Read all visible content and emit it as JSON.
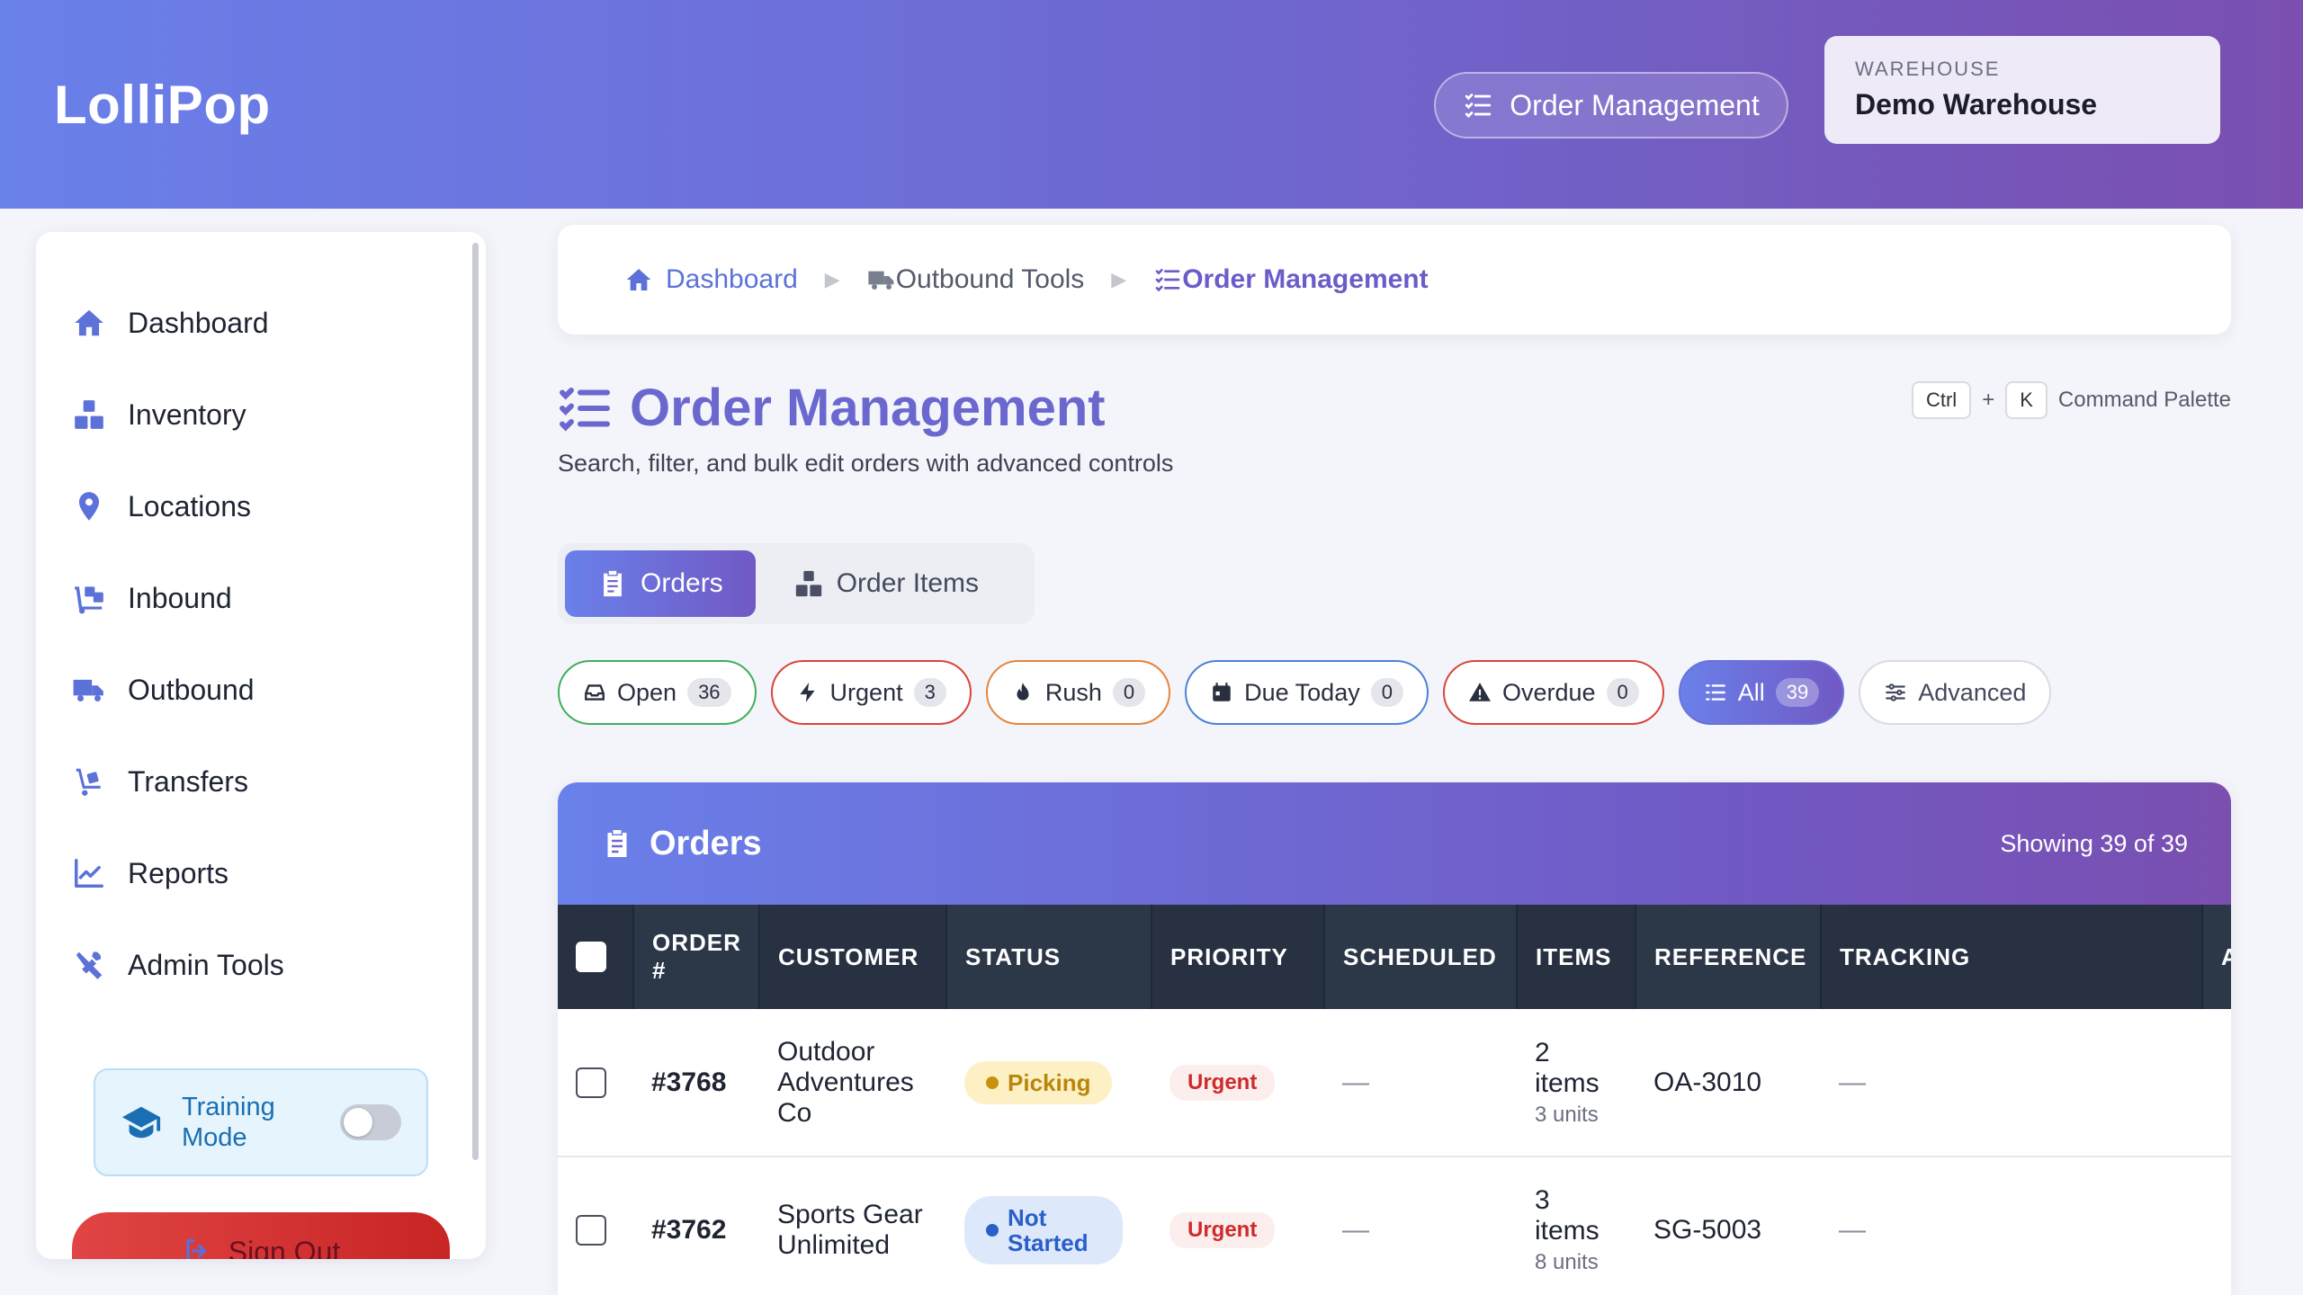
{
  "app": {
    "brand": "LolliPop",
    "header_pill": "Order Management",
    "warehouse_label": "WAREHOUSE",
    "warehouse_name": "Demo Warehouse"
  },
  "sidebar": {
    "items": [
      {
        "label": "Dashboard",
        "icon": "home-icon"
      },
      {
        "label": "Inventory",
        "icon": "boxes-icon"
      },
      {
        "label": "Locations",
        "icon": "map-pin-icon"
      },
      {
        "label": "Inbound",
        "icon": "dolly-icon"
      },
      {
        "label": "Outbound",
        "icon": "truck-icon"
      },
      {
        "label": "Transfers",
        "icon": "hand-truck-icon"
      },
      {
        "label": "Reports",
        "icon": "chart-line-icon"
      },
      {
        "label": "Admin Tools",
        "icon": "tools-icon"
      }
    ],
    "training_label": "Training Mode",
    "training_on": false,
    "signout_label": "Sign Out"
  },
  "breadcrumb": {
    "items": [
      "Dashboard",
      "Outbound Tools",
      "Order Management"
    ]
  },
  "page": {
    "title": "Order Management",
    "subtitle": "Search, filter, and bulk edit orders with advanced controls",
    "kbd_ctrl": "Ctrl",
    "kbd_plus": "+",
    "kbd_k": "K",
    "cmd_label": "Command Palette"
  },
  "tabs": [
    {
      "label": "Orders",
      "active": true
    },
    {
      "label": "Order Items",
      "active": false
    }
  ],
  "filters": [
    {
      "label": "Open",
      "count": "36",
      "color": "#3fae5b"
    },
    {
      "label": "Urgent",
      "count": "3",
      "color": "#d9443c"
    },
    {
      "label": "Rush",
      "count": "0",
      "color": "#e7843a"
    },
    {
      "label": "Due Today",
      "count": "0",
      "color": "#4a82d6"
    },
    {
      "label": "Overdue",
      "count": "0",
      "color": "#d9443c"
    },
    {
      "label": "All",
      "count": "39",
      "color": "#6a70d8"
    },
    {
      "label": "Advanced",
      "count": "",
      "color": "#d9dbe3"
    }
  ],
  "orders": {
    "title": "Orders",
    "showing": "Showing 39 of 39",
    "columns": [
      "ORDER #",
      "CUSTOMER",
      "STATUS",
      "PRIORITY",
      "SCHEDULED",
      "ITEMS",
      "REFERENCE",
      "TRACKING",
      "A"
    ],
    "rows": [
      {
        "order": "#3768",
        "customer": "Outdoor Adventures Co",
        "status": "Picking",
        "priority": "Urgent",
        "scheduled": "—",
        "items": "2 items",
        "units": "3 units",
        "reference": "OA-3010",
        "tracking": "—"
      },
      {
        "order": "#3762",
        "customer": "Sports Gear Unlimited",
        "status": "Not Started",
        "priority": "Urgent",
        "scheduled": "—",
        "items": "3 items",
        "units": "8 units",
        "reference": "SG-5003",
        "tracking": "—"
      }
    ]
  },
  "colors": {
    "accent": "#6a68cf",
    "picking_bg": "#fdf0c4",
    "picking_fg": "#b8860b",
    "notstarted_bg": "#dde9fb",
    "notstarted_fg": "#2a5fc9"
  }
}
